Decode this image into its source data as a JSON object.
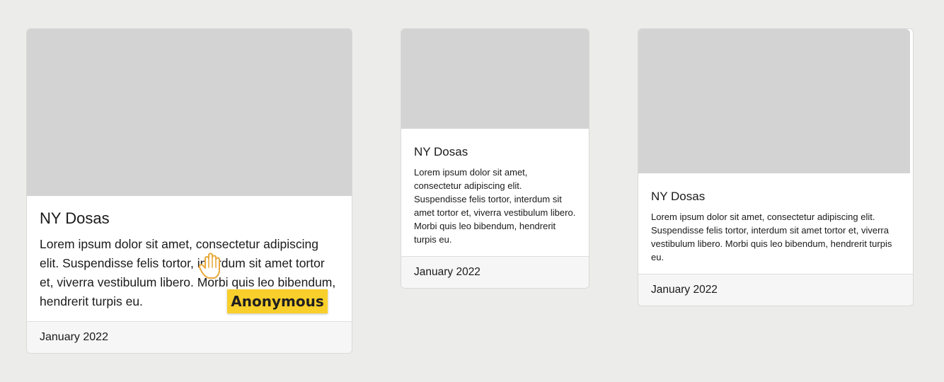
{
  "cards": [
    {
      "title": "NY Dosas",
      "text": "Lorem ipsum dolor sit amet, consectetur adipiscing elit. Suspendisse felis tortor, interdum sit amet tortor et, viverra vestibulum libero. Morbi quis leo bibendum, hendrerit turpis eu.",
      "date": "January 2022"
    },
    {
      "title": "NY Dosas",
      "text": "Lorem ipsum dolor sit amet, consectetur adipiscing elit. Suspendisse felis tortor, interdum sit amet tortor et, viverra vestibulum libero. Morbi quis leo bibendum, hendrerit turpis eu.",
      "date": "January 2022"
    },
    {
      "title": "NY Dosas",
      "text": "Lorem ipsum dolor sit amet, consectetur adipiscing elit. Suspendisse felis tortor, interdum sit amet tortor et, viverra vestibulum libero. Morbi quis leo bibendum, hendrerit turpis eu.",
      "date": "January 2022"
    }
  ],
  "cursor": {
    "icon": "hand-pointer-icon",
    "label": "Anonymous",
    "color": "#f9cf2b"
  },
  "colors": {
    "background": "#ececea",
    "image_placeholder": "#d3d3d3",
    "footer": "#f6f6f6"
  }
}
